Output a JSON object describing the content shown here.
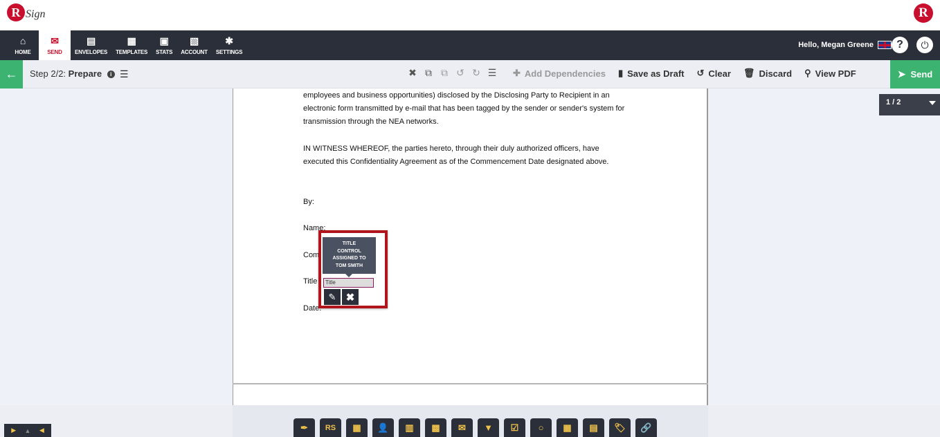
{
  "brand": {
    "logo_letter": "R",
    "logo_text": "Sign",
    "right_logo_letter": "R"
  },
  "nav": {
    "items": [
      {
        "label": "HOME",
        "icon": "⌂"
      },
      {
        "label": "SEND",
        "icon": "✉"
      },
      {
        "label": "ENVELOPES",
        "icon": "▤"
      },
      {
        "label": "TEMPLATES",
        "icon": "▦"
      },
      {
        "label": "STATS",
        "icon": "▣"
      },
      {
        "label": "ACCOUNT",
        "icon": "▧"
      },
      {
        "label": "SETTINGS",
        "icon": "✱"
      }
    ],
    "active": "SEND",
    "greeting": "Hello, Megan Greene",
    "help_glyph": "?",
    "power_glyph": "⏻"
  },
  "toolbar": {
    "step_prefix": "Step 2/2:",
    "step_name": "Prepare",
    "info_glyph": "i",
    "list_glyph": "☰",
    "back_glyph": "←",
    "icons": [
      "✖",
      "⧉",
      "⧉",
      "↺",
      "↻",
      "☰"
    ],
    "actions": {
      "add_dependencies": "Add Dependencies",
      "save_as_draft": "Save as Draft",
      "clear": "Clear",
      "discard": "Discard",
      "view_pdf": "View PDF",
      "send": "Send"
    },
    "action_icons": {
      "add_dependencies": "✚",
      "save_as_draft": "▮",
      "clear": "↺",
      "discard": "🗑",
      "view_pdf": "⚲",
      "send": "➤"
    }
  },
  "document": {
    "lines": [
      "employees and business opportunities) disclosed by the Disclosing Party to Recipient in an",
      "electronic form transmitted by e-mail that has been tagged by the sender or sender's system for",
      "transmission through the NEA networks.",
      "IN WITNESS WHEREOF, the parties hereto, through their duly authorized officers, have",
      "executed this Confidentiality Agreement as of the Commencement Date designated above.",
      "By:",
      "Name:",
      "Com",
      "Title",
      "Date:"
    ]
  },
  "pager": {
    "label": "1 / 2"
  },
  "title_control": {
    "tooltip": [
      "TITLE",
      "CONTROL",
      "ASSIGNED TO",
      "TOM SMITH"
    ],
    "field_value": "Title",
    "edit_glyph": "✎",
    "delete_glyph": "✖"
  },
  "mini_nav": [
    "▶",
    "▲",
    "◀"
  ],
  "palette": [
    {
      "name": "signature",
      "glyph": "✒"
    },
    {
      "name": "initials",
      "glyph": "RS"
    },
    {
      "name": "date-signed",
      "glyph": "▦"
    },
    {
      "name": "name",
      "glyph": "👤"
    },
    {
      "name": "title",
      "glyph": "▥"
    },
    {
      "name": "company",
      "glyph": "▩"
    },
    {
      "name": "email",
      "glyph": "✉"
    },
    {
      "name": "dropdown",
      "glyph": "▼"
    },
    {
      "name": "checkbox",
      "glyph": "☑"
    },
    {
      "name": "radio",
      "glyph": "○"
    },
    {
      "name": "date",
      "glyph": "▦"
    },
    {
      "name": "text",
      "glyph": "▤"
    },
    {
      "name": "label",
      "glyph": "🏷"
    },
    {
      "name": "hyperlink",
      "glyph": "🔗"
    }
  ]
}
